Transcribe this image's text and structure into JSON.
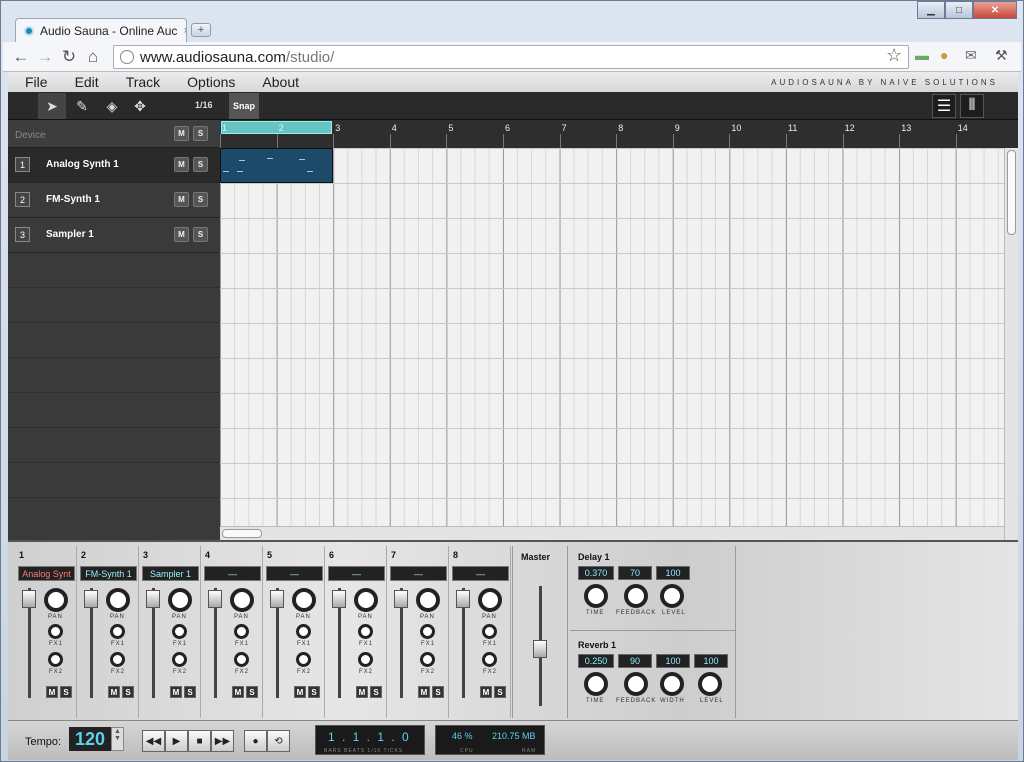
{
  "browser": {
    "tab_title": "Audio Sauna - Online Auc",
    "tab_close": "×",
    "new_tab": "+",
    "url_host": "www.audiosauna.com",
    "url_path": "/studio/",
    "win_min": "▁",
    "win_max": "□",
    "win_close": "✕"
  },
  "menu": {
    "items": [
      "File",
      "Edit",
      "Track",
      "Options",
      "About"
    ],
    "brand": "AUDIOSAUNA BY NAIVE SOLUTIONS"
  },
  "toolbar": {
    "quantize": "1/16",
    "snap": "Snap"
  },
  "tracks": {
    "header": "Device",
    "mute": "M",
    "solo": "S",
    "list": [
      {
        "num": "1",
        "name": "Analog Synth 1"
      },
      {
        "num": "2",
        "name": "FM-Synth 1"
      },
      {
        "num": "3",
        "name": "Sampler 1"
      }
    ]
  },
  "ruler": {
    "bars": [
      "1",
      "2",
      "3",
      "4",
      "5",
      "6",
      "7",
      "8",
      "9",
      "10",
      "11",
      "12",
      "13",
      "14"
    ]
  },
  "mixer": {
    "channels": [
      {
        "num": "1",
        "device": "Analog Synt"
      },
      {
        "num": "2",
        "device": "FM-Synth 1"
      },
      {
        "num": "3",
        "device": "Sampler 1"
      },
      {
        "num": "4",
        "device": "—"
      },
      {
        "num": "5",
        "device": "—"
      },
      {
        "num": "6",
        "device": "—"
      },
      {
        "num": "7",
        "device": "—"
      },
      {
        "num": "8",
        "device": "—"
      }
    ],
    "pan": "PAN",
    "fx1": "FX1",
    "fx2": "FX2",
    "mute": "M",
    "solo": "S",
    "master": "Master",
    "delay": {
      "title": "Delay 1",
      "time": "0.370",
      "feedback": "70",
      "level": "100",
      "l_time": "TIME",
      "l_feedback": "FEEDBACK",
      "l_level": "LEVEL"
    },
    "reverb": {
      "title": "Reverb 1",
      "time": "0.250",
      "feedback": "90",
      "width": "100",
      "level": "100",
      "l_time": "TIME",
      "l_feedback": "FEEDBACK",
      "l_width": "WIDTH",
      "l_level": "LEVEL"
    }
  },
  "transport": {
    "tempo_label": "Tempo:",
    "tempo": "120",
    "position": "1 . 1 . 1 . 0",
    "position_label": "BARS BEATS 1/16 TICKS",
    "cpu": "46 %",
    "ram": "210.75 MB",
    "cpu_label": "CPU",
    "ram_label": "RAM"
  }
}
